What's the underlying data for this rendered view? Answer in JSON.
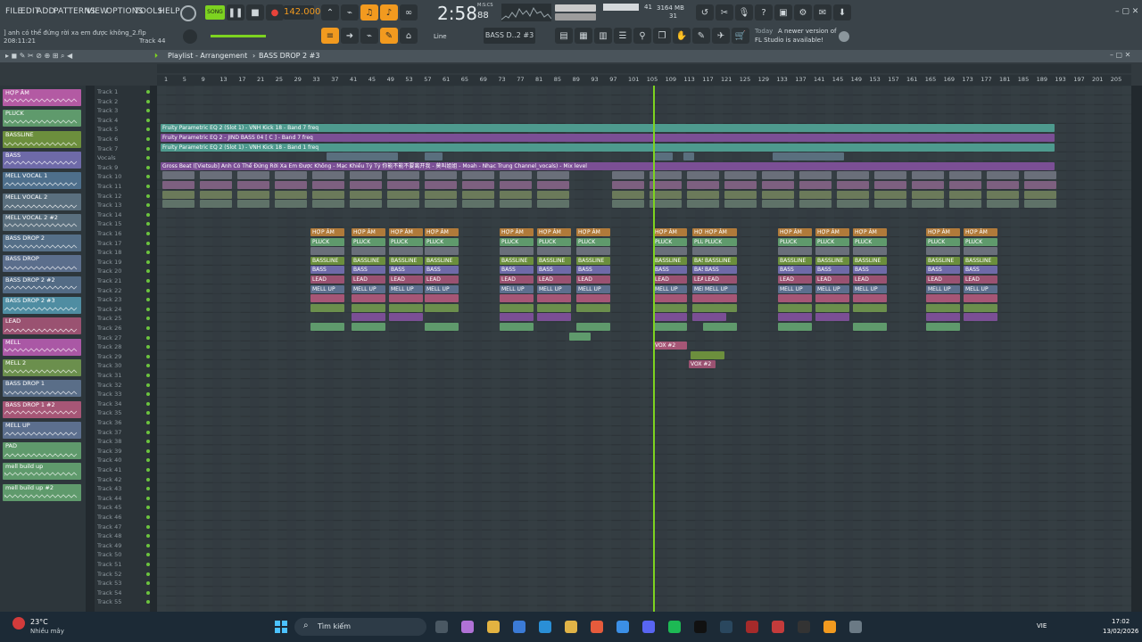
{
  "menu": [
    "FILE",
    "EDIT",
    "ADD",
    "PATTERNS",
    "VIEW",
    "OPTIONS",
    "TOOLS",
    "HELP"
  ],
  "project": {
    "name": "] anh có thể đứng rời xa em được không_2.flp",
    "time_hint": "208:11:21",
    "track_hint": "Track 44"
  },
  "transport": {
    "mode": "SONG",
    "tempo": "142.000",
    "time": "2:58",
    "time_frac": "88",
    "time_unit": "M:S:CS",
    "memory": "3164 MB",
    "cpu_top": "41",
    "cpu_bottom": "31"
  },
  "snap": {
    "label": "Line",
    "pattern": "BASS D..2 #3"
  },
  "news": {
    "line1": "Today",
    "line2": "A newer version of",
    "line3": "FL Studio is available!"
  },
  "playlist": {
    "title": "Playlist - Arrangement",
    "pattern": "BASS DROP 2 #3"
  },
  "ruler": [
    "1",
    "5",
    "9",
    "13",
    "17",
    "21",
    "25",
    "29",
    "33",
    "37",
    "41",
    "45",
    "49",
    "53",
    "57",
    "61",
    "65",
    "69",
    "73",
    "77",
    "81",
    "85",
    "89",
    "93",
    "97",
    "101",
    "105",
    "109",
    "113",
    "117",
    "121",
    "125",
    "129",
    "133",
    "137",
    "141",
    "145",
    "149",
    "153",
    "157",
    "161",
    "165",
    "169",
    "173",
    "177",
    "181",
    "185",
    "189",
    "193",
    "197",
    "201",
    "205"
  ],
  "channels": [
    {
      "name": "HỢP ÂM",
      "color": "#b35aa3"
    },
    {
      "name": "PLUCK",
      "color": "#5f9a6c"
    },
    {
      "name": "BASSLINE",
      "color": "#6c8f3d"
    },
    {
      "name": "BASS",
      "color": "#6e6aa8"
    },
    {
      "name": "MELL VOCAL 1",
      "color": "#4e6f8c"
    },
    {
      "name": "MELL VOCAL 2",
      "color": "#5a6f7e"
    },
    {
      "name": "MELL VOCAL 2 #2",
      "color": "#5a6f7e"
    },
    {
      "name": "BASS DROP 2",
      "color": "#556f88"
    },
    {
      "name": "BASS DROP",
      "color": "#5b6e8c"
    },
    {
      "name": "BASS DROP 2 #2",
      "color": "#536b85"
    },
    {
      "name": "BASS DROP 2 #3",
      "color": "#4f8da2"
    },
    {
      "name": "LEAD",
      "color": "#9a5271"
    },
    {
      "name": "MELL",
      "color": "#aa58a5"
    },
    {
      "name": "MELL 2",
      "color": "#6b8f4d"
    },
    {
      "name": "BASS DROP 1",
      "color": "#5a6e88"
    },
    {
      "name": "BASS DROP 1 #2",
      "color": "#a65676"
    },
    {
      "name": "MELL UP",
      "color": "#5c6f8e"
    },
    {
      "name": "PAD",
      "color": "#5f9a6c"
    },
    {
      "name": "mell build up",
      "color": "#5f9a6c"
    },
    {
      "name": "mell build up #2",
      "color": "#5f9a6c"
    }
  ],
  "automation_clips": [
    {
      "track": 5,
      "text": "Fruity Parametric EQ 2 (Slot 1) - VNH Kick 18 - Band 7 freq",
      "color": "#4e9a8e"
    },
    {
      "track": 6,
      "text": "Fruity Parametric EQ 2 - JIND BASS 04 [ C ] - Band 7 freq",
      "color": "#7b4f95"
    },
    {
      "track": 7,
      "text": "Fruity Parametric EQ 2 (Slot 1) - VNH Kick 18 - Band 1 freq",
      "color": "#4e9a8e"
    },
    {
      "track": 9,
      "text": "Gross Beat ([Vietsub] Anh Có Thể Đứng Rời Xa Em Được Không - Mạc Khiếu Tỷ Tỷ 你能不能不要离开我 - 莫叫姐姐 - Moah - Nhạc Trung Channel_vocals) - Mix level",
      "color": "#7b4f95"
    }
  ],
  "track_labels": [
    "Track 1",
    "Track 2",
    "Track 3",
    "Track 4",
    "Track 5",
    "Track 6",
    "Track 7",
    "Vocals",
    "Track 9",
    "Track 10",
    "Track 11",
    "Track 12",
    "Track 13",
    "Track 14",
    "Track 15",
    "Track 16",
    "Track 17",
    "Track 18",
    "Track 19",
    "Track 20",
    "Track 21",
    "Track 22",
    "Track 23",
    "Track 24",
    "Track 25",
    "Track 26",
    "Track 27",
    "Track 28",
    "Track 29",
    "Track 30",
    "Track 31",
    "Track 32",
    "Track 33",
    "Track 34",
    "Track 35",
    "Track 36",
    "Track 37",
    "Track 38",
    "Track 39",
    "Track 40",
    "Track 41",
    "Track 42",
    "Track 43",
    "Track 44",
    "Track 45",
    "Track 46",
    "Track 47",
    "Track 48",
    "Track 49",
    "Track 50",
    "Track 51",
    "Track 52",
    "Track 53",
    "Track 54",
    "Track 55"
  ],
  "clip_labels": {
    "hopam": "HỢP ÂM",
    "pluck": "PLUCK",
    "bassline": "BASSLINE",
    "bass": "BASS",
    "lead": "LEAD",
    "pad": "PAD",
    "vox": "VOX #2",
    "mell": "MELL UP"
  },
  "taskbar": {
    "weather_temp": "23°C",
    "weather_desc": "Nhiều mây",
    "search": "Tìm kiếm",
    "lang": "VIE",
    "time": "17:02",
    "date": "13/02/2026"
  },
  "colors": {
    "accent": "#f29a1f",
    "playhead": "#7dd320",
    "grid": "#343d42"
  }
}
